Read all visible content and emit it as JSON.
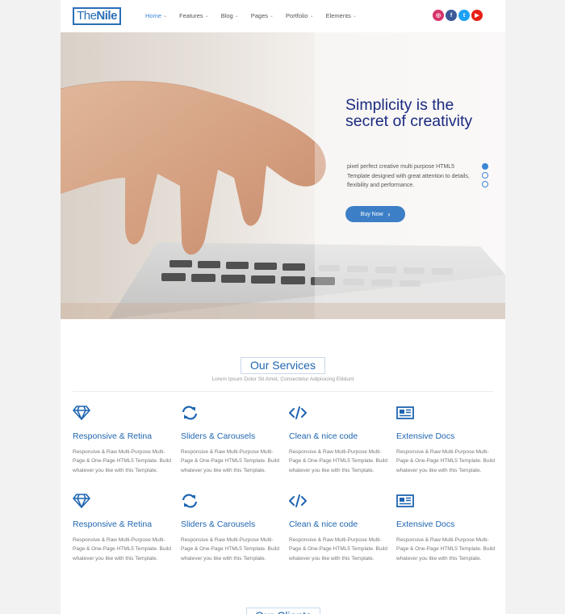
{
  "header": {
    "logo_part1": "The",
    "logo_part2": "Nile",
    "nav": [
      "Home",
      "Features",
      "Blog",
      "Pages",
      "Portfolio",
      "Elements"
    ],
    "social": [
      {
        "name": "instagram-icon",
        "glyph": "◎",
        "color": "#d6336c"
      },
      {
        "name": "facebook-icon",
        "glyph": "f",
        "color": "#3b5998"
      },
      {
        "name": "twitter-icon",
        "glyph": "t",
        "color": "#1da1f2"
      },
      {
        "name": "youtube-icon",
        "glyph": "▶",
        "color": "#e62117"
      }
    ]
  },
  "hero": {
    "title": "Simplicity is the secret of creativity",
    "description": "pixel perfect creative multi purpose HTML5 Template designed with great attention to details, flexibility and performance.",
    "button_label": "Buy Now",
    "slides": 3,
    "active_slide": 1
  },
  "services": {
    "title": "Our Services",
    "subtitle": "Lorem Ipsum Dolor Sit Amet, Consectetur Adipisicing Elitdunt",
    "items": [
      {
        "icon": "diamond-icon",
        "name": "Responsive & Retina",
        "desc": "Responsive & Raw Multi-Purpose Multi-Page & One-Page HTML5 Template. Build whatever you like with this Template."
      },
      {
        "icon": "refresh-icon",
        "name": "Sliders & Carousels",
        "desc": "Responsive & Raw Multi-Purpose Multi-Page & One-Page HTML5 Template. Build whatever you like with this Template."
      },
      {
        "icon": "code-icon",
        "name": "Clean & nice code",
        "desc": "Responsive & Raw Multi-Purpose Multi-Page & One-Page HTML5 Template. Build whatever you like with this Template."
      },
      {
        "icon": "newspaper-icon",
        "name": "Extensive Docs",
        "desc": "Responsive & Raw Multi-Purpose Multi-Page & One-Page HTML5 Template. Build whatever you like with this Template."
      },
      {
        "icon": "diamond-icon",
        "name": "Responsive & Retina",
        "desc": "Responsive & Raw Multi-Purpose Multi-Page & One-Page HTML5 Template. Build whatever you like with this Template."
      },
      {
        "icon": "refresh-icon",
        "name": "Sliders & Carousels",
        "desc": "Responsive & Raw Multi-Purpose Multi-Page & One-Page HTML5 Template. Build whatever you like with this Template."
      },
      {
        "icon": "code-icon",
        "name": "Clean & nice code",
        "desc": "Responsive & Raw Multi-Purpose Multi-Page & One-Page HTML5 Template. Build whatever you like with this Template."
      },
      {
        "icon": "newspaper-icon",
        "name": "Extensive Docs",
        "desc": "Responsive & Raw Multi-Purpose Multi-Page & One-Page HTML5 Template. Build whatever you like with this Template."
      }
    ]
  },
  "clients": {
    "title": "Our Clients"
  },
  "colors": {
    "accent": "#1f65b0",
    "button": "#3d7fc6",
    "hero_title": "#1a2a80"
  }
}
